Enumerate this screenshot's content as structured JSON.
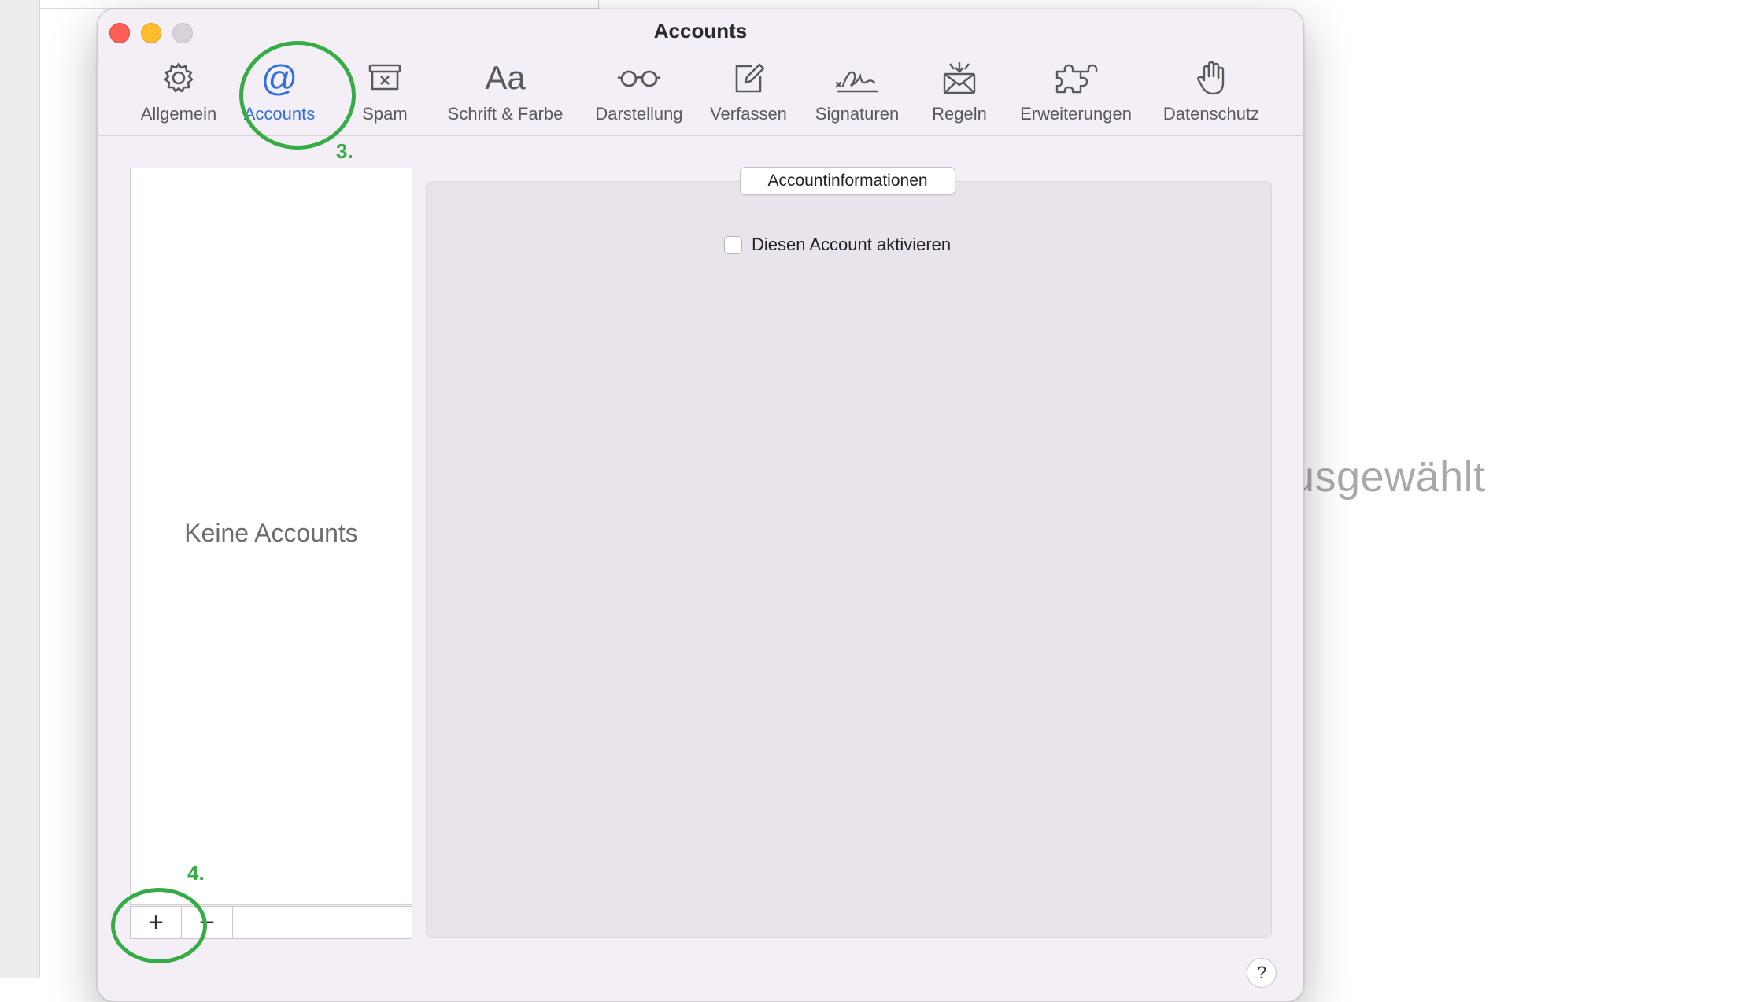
{
  "background": {
    "empty_text": "usgewählt"
  },
  "window": {
    "title": "Accounts",
    "tabs": [
      {
        "id": "allgemein",
        "label": "Allgemein",
        "icon": "gear-icon"
      },
      {
        "id": "accounts",
        "label": "Accounts",
        "icon": "at-sign-icon",
        "active": true
      },
      {
        "id": "spam",
        "label": "Spam",
        "icon": "junk-box-icon"
      },
      {
        "id": "schrift",
        "label": "Schrift & Farbe",
        "icon": "font-icon",
        "icon_text": "Aa"
      },
      {
        "id": "darstellung",
        "label": "Darstellung",
        "icon": "glasses-icon"
      },
      {
        "id": "verfassen",
        "label": "Verfassen",
        "icon": "compose-icon"
      },
      {
        "id": "signaturen",
        "label": "Signaturen",
        "icon": "signature-icon"
      },
      {
        "id": "regeln",
        "label": "Regeln",
        "icon": "rules-envelope-icon"
      },
      {
        "id": "erweiterungen",
        "label": "Erweiterungen",
        "icon": "puzzle-icon"
      },
      {
        "id": "datenschutz",
        "label": "Datenschutz",
        "icon": "hand-icon"
      }
    ],
    "account_list": {
      "empty_text": "Keine Accounts",
      "add_label": "+",
      "remove_label": "−"
    },
    "detail": {
      "section_label": "Accountinformationen",
      "enable_checkbox_label": "Diesen Account aktivieren",
      "enable_checked": false
    },
    "help_label": "?"
  },
  "annotations": {
    "step3": "3.",
    "step4": "4.",
    "color": "#36ad44"
  },
  "colors": {
    "accent": "#2f6fe0",
    "close": "#ff5f57",
    "minimize": "#febc2e"
  }
}
